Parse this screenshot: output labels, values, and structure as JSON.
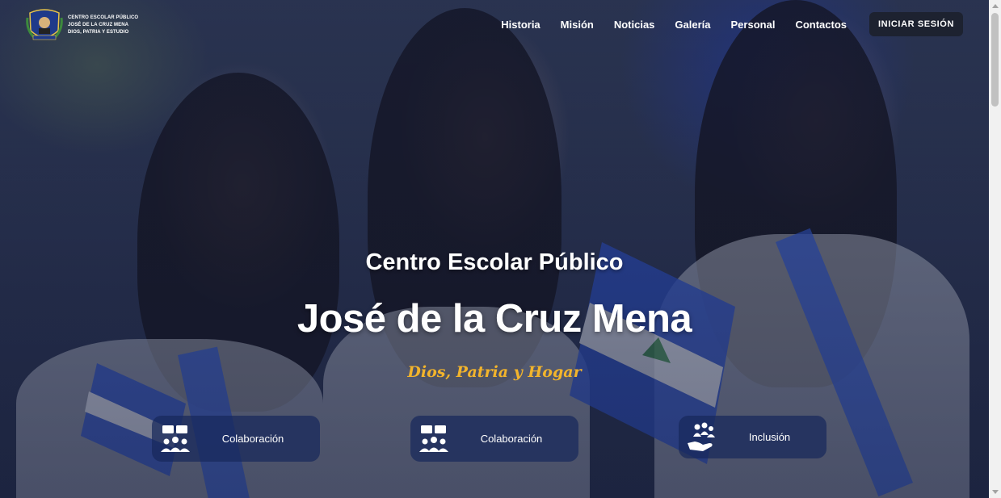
{
  "header": {
    "logo_lines": [
      "CENTRO ESCOLAR PÚBLICO",
      "JOSÉ DE LA CRUZ MENA",
      "DIOS, PATRIA Y ESTUDIO"
    ],
    "nav": [
      "Historia",
      "Misión",
      "Noticias",
      "Galería",
      "Personal",
      "Contactos"
    ],
    "login_label": "INICIAR SESIÓN"
  },
  "hero": {
    "subtitle": "Centro Escolar Público",
    "title": "José de la Cruz Mena",
    "motto": "Dios, Patria y Hogar"
  },
  "features": [
    {
      "label": "Colaboración",
      "icon": "group-meeting-icon"
    },
    {
      "label": "Colaboración",
      "icon": "group-meeting-icon"
    },
    {
      "label": "Inclusión",
      "icon": "hand-people-icon"
    }
  ],
  "colors": {
    "accent": "#f2b42c",
    "login_bg": "#1d2230",
    "card_bg": "#18285c"
  }
}
